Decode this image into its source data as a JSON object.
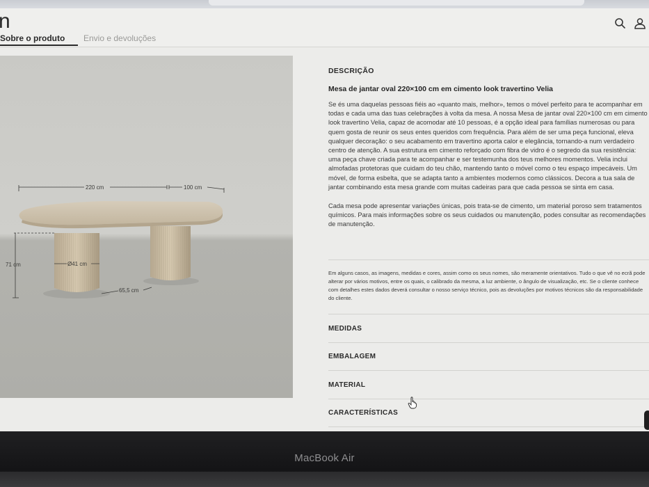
{
  "header": {
    "logo": "n",
    "tabs": [
      {
        "label": "Sobre o produto",
        "active": true
      },
      {
        "label": "Envio e devoluções",
        "active": false
      }
    ],
    "icons": [
      "search-icon",
      "user-icon"
    ]
  },
  "image_annotations": {
    "length": "220 cm",
    "width": "100 cm",
    "height": "71 cm",
    "leg_diameter": "Ø41 cm",
    "leg_spacing": "65,5 cm"
  },
  "description": {
    "heading": "DESCRIÇÃO",
    "title": "Mesa de jantar oval 220×100 cm em cimento look travertino Velia",
    "paragraph1": "Se és uma daquelas pessoas fiéis ao «quanto mais, melhor», temos o móvel perfeito para te acompanhar em todas e cada uma das tuas celebrações à volta da mesa. A nossa Mesa de jantar oval 220×100 cm em cimento look travertino Velia, capaz de acomodar até 10 pessoas, é a opção ideal para famílias numerosas ou para quem gosta de reunir os seus entes queridos com frequência. Para além de ser uma peça funcional, eleva qualquer decoração: o seu acabamento em travertino aporta calor e elegância, tornando-a num verdadeiro centro de atenção. A sua estrutura em cimento reforçado com fibra de vidro é o segredo da sua resistência: uma peça chave criada para te acompanhar e ser testemunha dos teus melhores momentos. Velia inclui almofadas protetoras que cuidam do teu chão, mantendo tanto o móvel como o teu espaço impecáveis. Um móvel, de forma esbelta, que se adapta tanto a ambientes modernos como clássicos. Decora a tua sala de jantar combinando esta mesa grande com muitas cadeiras para que cada pessoa se sinta em casa.",
    "paragraph2": "Cada mesa pode apresentar variações únicas, pois trata-se de cimento, um material poroso sem tratamentos químicos. Para mais informações sobre os seus cuidados ou manutenção, podes consultar as recomendações de manutenção.",
    "note": "Em alguns casos, as imagens, medidas e cores, assim como os seus nomes, são meramente orientativos. Tudo o que vê no ecrã pode alterar por vários motivos, entre os quais, o calibrado da mesma, a luz ambiente, o ângulo de visualização, etc. Se o cliente conhece com detalhes estes dados deverá consultar o nosso serviço técnico, pois as devoluções por motivos técnicos são da responsabilidade do cliente."
  },
  "accordion": [
    {
      "label": "MEDIDAS"
    },
    {
      "label": "EMBALAGEM"
    },
    {
      "label": "MATERIAL"
    },
    {
      "label": "CARACTERÍSTICAS"
    }
  ],
  "device": {
    "label": "MacBook Air"
  },
  "colors": {
    "page_bg": "#ececea",
    "text": "#2e2e2e",
    "muted": "#9a9a98",
    "bezel": "#161618"
  }
}
